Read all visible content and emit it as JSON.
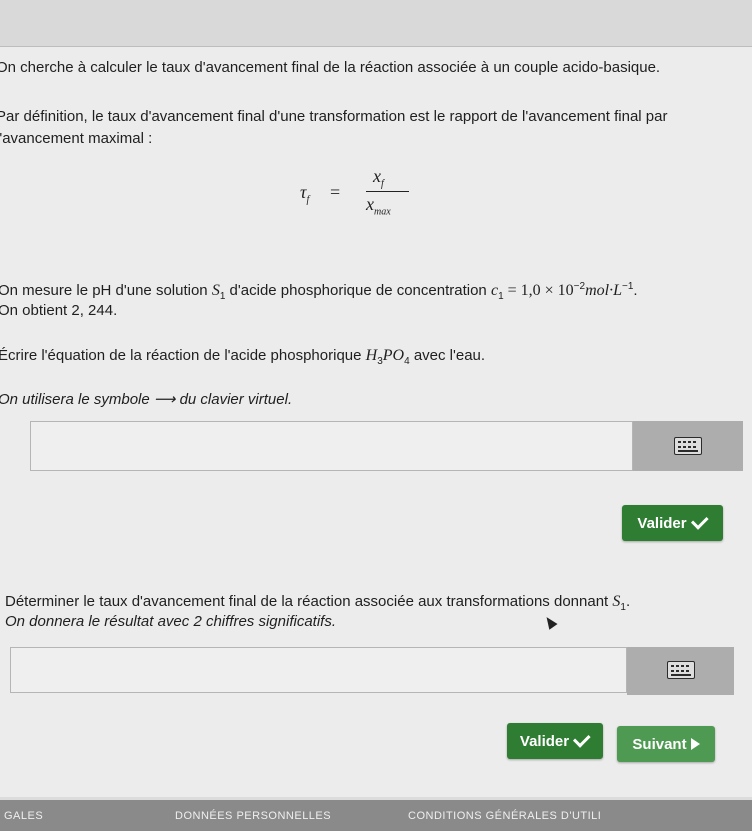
{
  "intro": "On cherche à calculer le taux d'avancement final de la réaction associée à un couple acido-basique.",
  "definition_line1": "Par définition, le taux d'avancement final d'une transformation est le rapport de l'avancement final par",
  "definition_line2": "l'avancement maximal :",
  "formula": {
    "lhs": "τ",
    "lhs_sub": "f",
    "eq": "=",
    "num": "x",
    "num_sub": "f",
    "den": "x",
    "den_sub": "max"
  },
  "measure": {
    "text_before": "On mesure le pH d'une solution ",
    "sym": "S",
    "sym_sub": "1",
    "text_mid": " d'acide phosphorique de concentration ",
    "conc": "c",
    "conc_sub": "1",
    "conc_val": " = 1,0 × 10",
    "exp": "−2",
    "unit": "mol·L",
    "unit_exp": "−1",
    "end": "."
  },
  "obtained": "On obtient 2, 244.",
  "question1": {
    "before": "Écrire l'équation de la réaction de l'acide phosphorique ",
    "h": "H",
    "h_sub": "3",
    "po": "PO",
    "po_sub": "4",
    "after": " avec l'eau."
  },
  "hint1": "On utilisera le symbole ⟶ du clavier virtuel.",
  "answer1_value": "",
  "validate_label": "Valider",
  "question2": {
    "before": "Déterminer le taux d'avancement final de la réaction associée aux transformations donnant ",
    "sym": "S",
    "sym_sub": "1",
    "end": "."
  },
  "hint2": "On donnera le résultat avec 2 chiffres significatifs.",
  "answer2_value": "",
  "validate2_label": "Valider",
  "next_label": "Suivant",
  "footer": {
    "left": "GALES",
    "middle": "DONNÉES PERSONNELLES",
    "right": "CONDITIONS GÉNÉRALES D'UTILI"
  },
  "icons": {
    "keyboard": "keyboard-icon",
    "check": "check-icon",
    "next": "play-arrow-icon"
  },
  "colors": {
    "green": "#2e7d32",
    "next_green": "#4f9a53"
  }
}
